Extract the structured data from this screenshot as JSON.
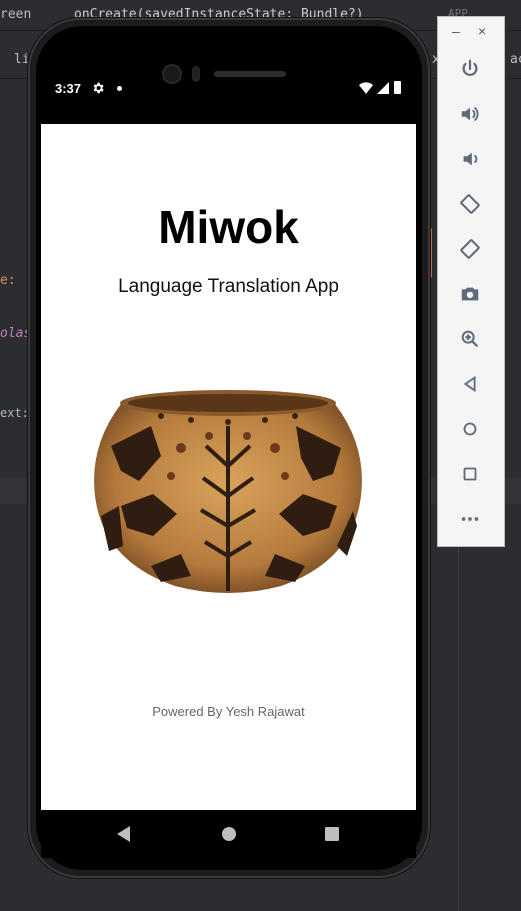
{
  "ide": {
    "breadcrumb_left": "reen",
    "breadcrumb_method": "onCreate(savedInstanceState: Bundle?)",
    "run_config": "APP",
    "tab_fragment_left": "lis",
    "tab_fragment_right1": "xn",
    "tab_fragment_right2": "ac",
    "code_fragment_1": "e:",
    "code_fragment_2": "olas",
    "code_fragment_3": "ext:"
  },
  "status_bar": {
    "time": "3:37"
  },
  "app": {
    "title": "Miwok",
    "subtitle": "Language Translation App",
    "footer": "Powered By Yesh Rajawat"
  },
  "emulator_toolbar": {
    "minimize": "–",
    "close": "×",
    "buttons": [
      "power-icon",
      "volume-up-icon",
      "volume-down-icon",
      "rotate-left-icon",
      "rotate-right-icon",
      "camera-icon",
      "zoom-icon",
      "back-icon",
      "home-icon",
      "overview-icon",
      "more-icon"
    ]
  },
  "colors": {
    "ide_bg": "#2b2d30",
    "screen_bg": "#ffffff",
    "toolbar_icon": "#5f6b7a"
  }
}
